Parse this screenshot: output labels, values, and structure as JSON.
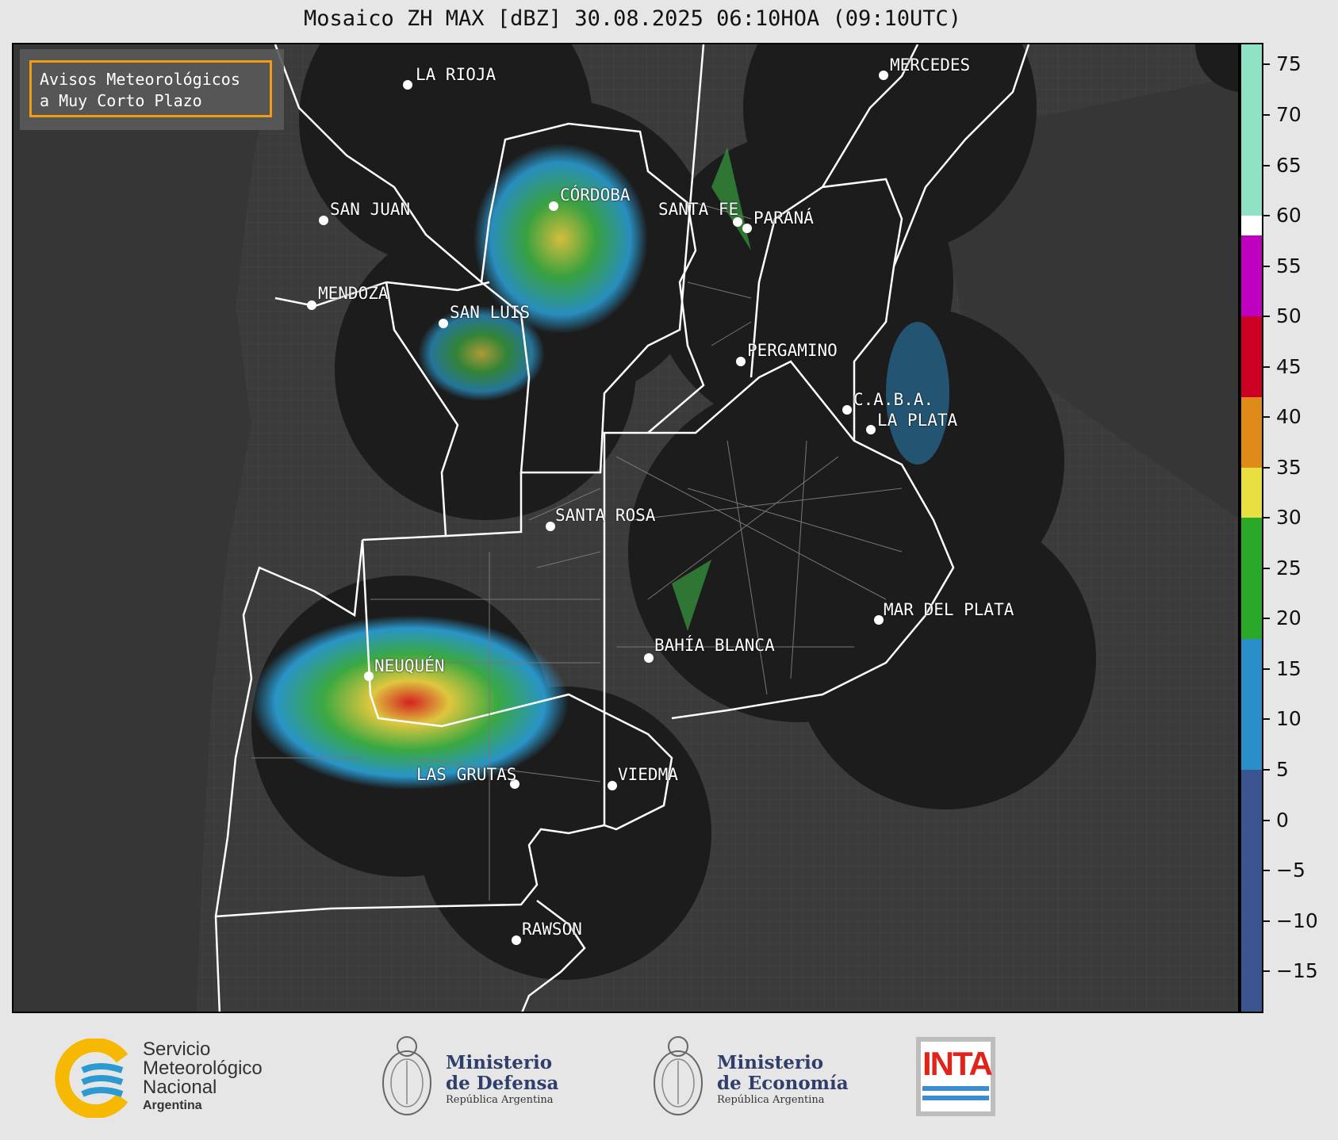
{
  "title": "Mosaico ZH MAX [dBZ] 30.08.2025 06:10HOA (09:10UTC)",
  "warning_box": {
    "line1": "Avisos Meteorológicos",
    "line2": "a Muy Corto Plazo"
  },
  "cities": [
    {
      "name": "LA RIOJA"
    },
    {
      "name": "MERCEDES"
    },
    {
      "name": "CÓRDOBA"
    },
    {
      "name": "SAN JUAN"
    },
    {
      "name": "SANTA FE"
    },
    {
      "name": "PARANÁ"
    },
    {
      "name": "MENDOZA"
    },
    {
      "name": "SAN LUIS"
    },
    {
      "name": "PERGAMINO"
    },
    {
      "name": "C.A.B.A."
    },
    {
      "name": "LA PLATA"
    },
    {
      "name": "SANTA ROSA"
    },
    {
      "name": "MAR DEL PLATA"
    },
    {
      "name": "BAHÍA BLANCA"
    },
    {
      "name": "NEUQUÉN"
    },
    {
      "name": "LAS GRUTAS"
    },
    {
      "name": "VIEDMA"
    },
    {
      "name": "RAWSON"
    }
  ],
  "colorbar": {
    "ticks": [
      "75",
      "70",
      "65",
      "60",
      "55",
      "50",
      "45",
      "40",
      "35",
      "30",
      "25",
      "20",
      "15",
      "10",
      "5",
      "0",
      "−5",
      "−10",
      "−15"
    ],
    "min": -19,
    "max": 77,
    "bands": [
      {
        "from": 60,
        "to": 77,
        "color": "#8fe3c4"
      },
      {
        "from": 58,
        "to": 60,
        "color": "#ffffff"
      },
      {
        "from": 50,
        "to": 58,
        "color": "#c000c0"
      },
      {
        "from": 42,
        "to": 50,
        "color": "#cc0022"
      },
      {
        "from": 35,
        "to": 42,
        "color": "#e08a1a"
      },
      {
        "from": 30,
        "to": 35,
        "color": "#e8e040"
      },
      {
        "from": 18,
        "to": 30,
        "color": "#2aa82a"
      },
      {
        "from": 5,
        "to": 18,
        "color": "#2a8ec8"
      },
      {
        "from": -19,
        "to": 5,
        "color": "#3a5590"
      }
    ]
  },
  "footer": {
    "smn": {
      "line1": "Servicio",
      "line2": "Meteorológico",
      "line3": "Nacional",
      "sub": "Argentina"
    },
    "defensa": {
      "line1": "Ministerio",
      "line2": "de Defensa",
      "sub": "República Argentina"
    },
    "economia": {
      "line1": "Ministerio",
      "line2": "de Economía",
      "sub": "República Argentina"
    },
    "inta": {
      "text": "INTA"
    }
  }
}
